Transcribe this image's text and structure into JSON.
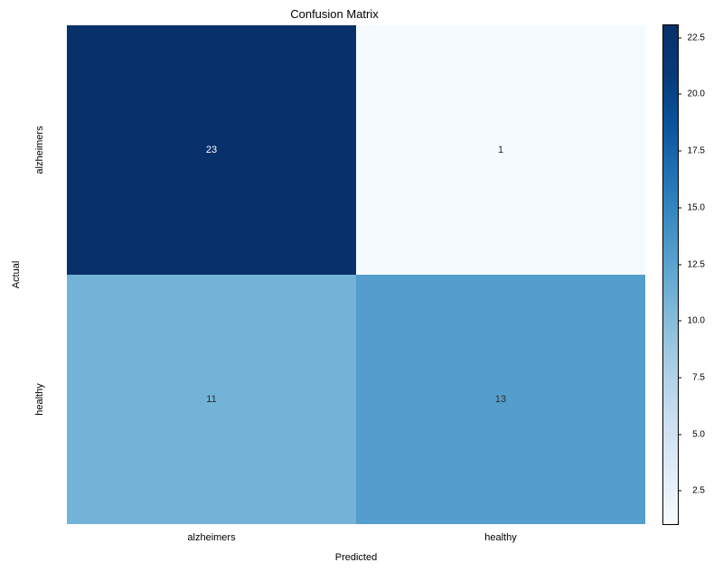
{
  "chart_data": {
    "type": "heatmap",
    "title": "Confusion Matrix",
    "xlabel": "Predicted",
    "ylabel": "Actual",
    "x_categories": [
      "alzheimers",
      "healthy"
    ],
    "y_categories": [
      "alzheimers",
      "healthy"
    ],
    "values": [
      [
        23,
        1
      ],
      [
        11,
        13
      ]
    ],
    "colorbar_ticks": [
      "2.5",
      "5.0",
      "7.5",
      "10.0",
      "12.5",
      "15.0",
      "17.5",
      "20.0",
      "22.5"
    ],
    "vmin": 1,
    "vmax": 23,
    "cell_colors": [
      [
        "#08306b",
        "#f5fafe"
      ],
      [
        "#74b3d8",
        "#539ecd"
      ]
    ],
    "cell_text_colors": [
      [
        "#ffffff",
        "#2a2a2a"
      ],
      [
        "#2a2a2a",
        "#2a2a2a"
      ]
    ]
  }
}
